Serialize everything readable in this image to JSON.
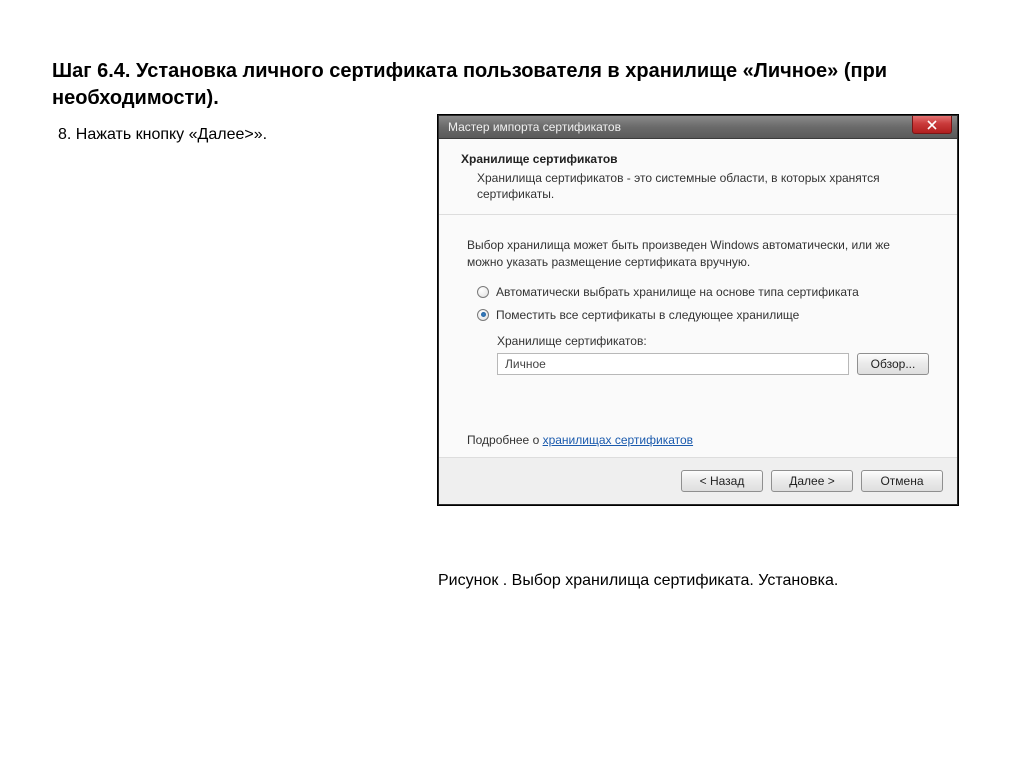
{
  "page": {
    "heading": "Шаг 6.4. Установка личного сертификата пользователя в хранилище «Личное» (при необходимости).",
    "instruction": "8. Нажать кнопку «Далее>».",
    "caption": "Рисунок . Выбор хранилища сертификата. Установка."
  },
  "dialog": {
    "title": "Мастер импорта сертификатов",
    "header": {
      "title": "Хранилище сертификатов",
      "desc": "Хранилища сертификатов - это системные области, в которых хранятся сертификаты."
    },
    "body": {
      "intro": "Выбор хранилища может быть произведен Windows автоматически, или же можно указать размещение сертификата вручную.",
      "radio1": "Автоматически выбрать хранилище на основе типа сертификата",
      "radio2": "Поместить все сертификаты в следующее хранилище",
      "store_label": "Хранилище сертификатов:",
      "store_value": "Личное",
      "browse": "Обзор...",
      "more_prefix": "Подробнее о ",
      "more_link": "хранилищах сертификатов"
    },
    "footer": {
      "back": "< Назад",
      "next": "Далее >",
      "cancel": "Отмена"
    }
  }
}
